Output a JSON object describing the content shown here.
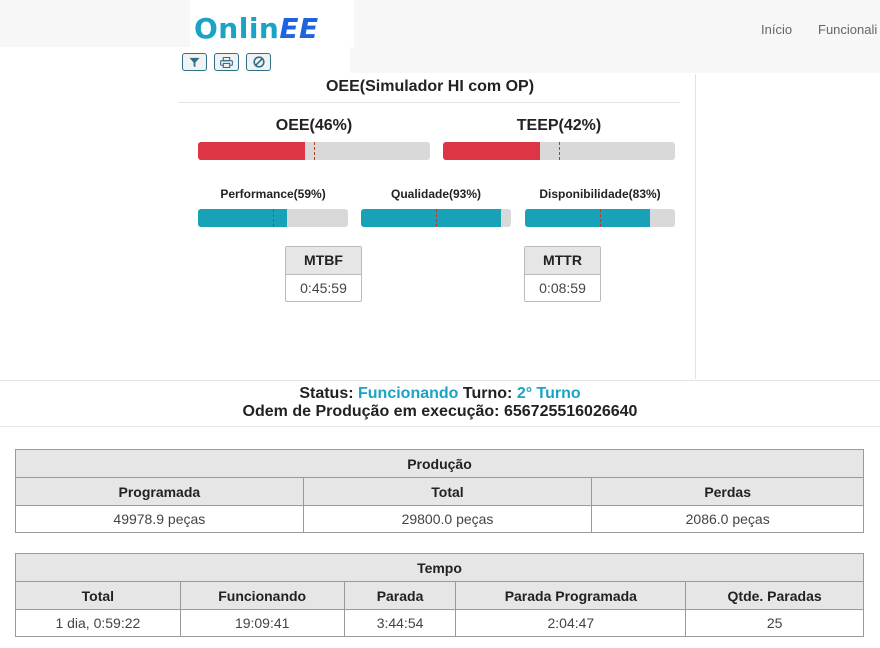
{
  "app": {
    "logo_part1": "Onlin",
    "logo_part2": "EE",
    "nav": [
      "Início",
      "Funcionali"
    ]
  },
  "toolbar": {
    "icons": [
      "filter-icon",
      "print-icon",
      "ban-icon"
    ]
  },
  "oee_panel": {
    "title": "OEE(Simulador HI com OP)",
    "main": [
      {
        "label": "OEE(46%)",
        "value": 0.46,
        "target": 0.5,
        "color": "#dc3545"
      },
      {
        "label": "TEEP(42%)",
        "value": 0.42,
        "target": 0.5,
        "color": "#dc3545"
      }
    ],
    "sub": [
      {
        "label": "Performance(59%)",
        "value": 0.59,
        "target": 0.5,
        "color": "#17a2b8"
      },
      {
        "label": "Qualidade(93%)",
        "value": 0.93,
        "target": 0.5,
        "color": "#17a2b8"
      },
      {
        "label": "Disponibilidade(83%)",
        "value": 0.83,
        "target": 0.5,
        "color": "#17a2b8"
      }
    ],
    "mtbf": {
      "label": "MTBF",
      "value": "0:45:59"
    },
    "mttr": {
      "label": "MTTR",
      "value": "0:08:59"
    }
  },
  "status": {
    "status_label": "Status:",
    "status_value": "Funcionando",
    "turno_label": "Turno:",
    "turno_value": "2° Turno",
    "ordem_label": "Odem de Produção em execução:",
    "ordem_value": "656725516026640"
  },
  "producao": {
    "title": "Produção",
    "headers": [
      "Programada",
      "Total",
      "Perdas"
    ],
    "row": [
      "49978.9 peças",
      "29800.0 peças",
      "2086.0 peças"
    ]
  },
  "tempo": {
    "title": "Tempo",
    "headers": [
      "Total",
      "Funcionando",
      "Parada",
      "Parada Programada",
      "Qtde. Paradas"
    ],
    "row": [
      "1 dia, 0:59:22",
      "19:09:41",
      "3:44:54",
      "2:04:47",
      "25"
    ]
  }
}
